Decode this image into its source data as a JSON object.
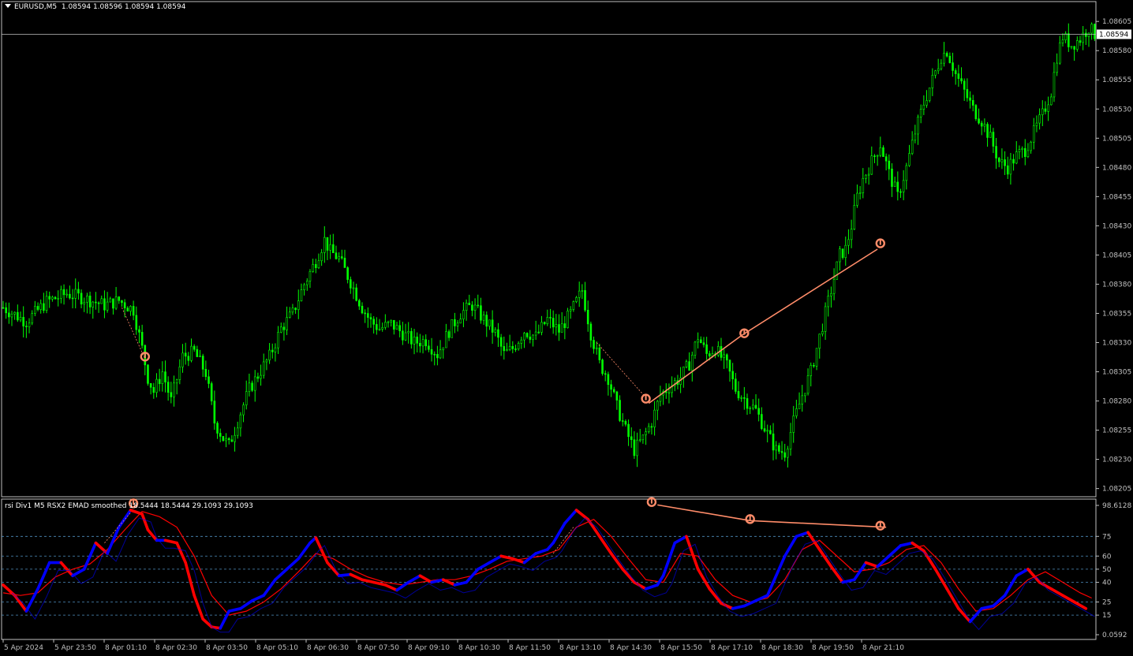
{
  "header": {
    "symbol": "EURUSD,M5",
    "ohlc": "1.08594 1.08596 1.08594 1.08594"
  },
  "indicator": {
    "title": "rsi Div1 M5 RSX2 EMAD smoothed 18.5444 18.5444 29.1093 29.1093",
    "levels": [
      "98.6128",
      "75",
      "60",
      "50",
      "40",
      "25",
      "15",
      "0.0592"
    ],
    "level_values": [
      98.6128,
      75,
      60,
      50,
      40,
      25,
      15,
      0.0592
    ]
  },
  "price_axis": {
    "labels": [
      "1.08605",
      "1.08580",
      "1.08555",
      "1.08530",
      "1.08505",
      "1.08480",
      "1.08455",
      "1.08430",
      "1.08405",
      "1.08380",
      "1.08355",
      "1.08330",
      "1.08305",
      "1.08280",
      "1.08255",
      "1.08230",
      "1.08205"
    ],
    "current_price": "1.08594",
    "current_value": 1.08594
  },
  "time_axis": {
    "labels": [
      "5 Apr 2024",
      "5 Apr 23:50",
      "8 Apr 01:10",
      "8 Apr 02:30",
      "8 Apr 03:50",
      "8 Apr 05:10",
      "8 Apr 06:30",
      "8 Apr 07:50",
      "8 Apr 09:10",
      "8 Apr 10:30",
      "8 Apr 11:50",
      "8 Apr 13:10",
      "8 Apr 14:30",
      "8 Apr 15:50",
      "8 Apr 17:10",
      "8 Apr 18:30",
      "8 Apr 19:50",
      "8 Apr 21:10"
    ]
  },
  "colors": {
    "background": "#000000",
    "candles": "#00ff00",
    "rsi_fast_up": "#0000ff",
    "rsi_fast_down": "#ff0000",
    "rsi_signal": "#ff0000",
    "divergence": "#ff8c69",
    "grid_dash": "#4f8fbf",
    "axis": "#c0c0c0"
  },
  "chart_data": {
    "type": "candlestick",
    "symbol": "EURUSD",
    "timeframe": "M5",
    "price_range": [
      1.08198,
      1.08622
    ],
    "close_path": [
      [
        0,
        1.0836
      ],
      [
        8,
        1.08348
      ],
      [
        15,
        1.08365
      ],
      [
        22,
        1.08372
      ],
      [
        28,
        1.08368
      ],
      [
        35,
        1.08362
      ],
      [
        40,
        1.08366
      ],
      [
        45,
        1.08358
      ],
      [
        48,
        1.08325
      ],
      [
        50,
        1.083
      ],
      [
        52,
        1.08288
      ],
      [
        55,
        1.08305
      ],
      [
        58,
        1.0828
      ],
      [
        62,
        1.08318
      ],
      [
        66,
        1.08322
      ],
      [
        70,
        1.08304
      ],
      [
        73,
        1.08262
      ],
      [
        76,
        1.08248
      ],
      [
        78,
        1.08242
      ],
      [
        80,
        1.08255
      ],
      [
        82,
        1.0827
      ],
      [
        85,
        1.0829
      ],
      [
        88,
        1.08302
      ],
      [
        92,
        1.08318
      ],
      [
        96,
        1.08342
      ],
      [
        100,
        1.08355
      ],
      [
        104,
        1.0838
      ],
      [
        108,
        1.084
      ],
      [
        111,
        1.08418
      ],
      [
        113,
        1.08408
      ],
      [
        116,
        1.08402
      ],
      [
        120,
        1.08382
      ],
      [
        124,
        1.0836
      ],
      [
        127,
        1.08348
      ],
      [
        130,
        1.08342
      ],
      [
        134,
        1.08346
      ],
      [
        138,
        1.08338
      ],
      [
        142,
        1.0833
      ],
      [
        146,
        1.08332
      ],
      [
        150,
        1.0832
      ],
      [
        154,
        1.0834
      ],
      [
        158,
        1.08355
      ],
      [
        162,
        1.08362
      ],
      [
        166,
        1.0835
      ],
      [
        170,
        1.08338
      ],
      [
        173,
        1.0832
      ],
      [
        176,
        1.08325
      ],
      [
        180,
        1.0834
      ],
      [
        184,
        1.08335
      ],
      [
        188,
        1.0835
      ],
      [
        192,
        1.0834
      ],
      [
        196,
        1.08355
      ],
      [
        200,
        1.08375
      ],
      [
        203,
        1.08338
      ],
      [
        206,
        1.08312
      ],
      [
        209,
        1.083
      ],
      [
        212,
        1.08275
      ],
      [
        215,
        1.08255
      ],
      [
        218,
        1.08238
      ],
      [
        221,
        1.08248
      ],
      [
        224,
        1.08262
      ],
      [
        227,
        1.08285
      ],
      [
        230,
        1.08292
      ],
      [
        234,
        1.083
      ],
      [
        237,
        1.08312
      ],
      [
        240,
        1.08335
      ],
      [
        243,
        1.0832
      ],
      [
        246,
        1.08325
      ],
      [
        250,
        1.0831
      ],
      [
        253,
        1.0829
      ],
      [
        256,
        1.08282
      ],
      [
        260,
        1.08272
      ],
      [
        264,
        1.08252
      ],
      [
        267,
        1.08238
      ],
      [
        270,
        1.08236
      ],
      [
        273,
        1.08262
      ],
      [
        276,
        1.08285
      ],
      [
        279,
        1.08305
      ],
      [
        282,
        1.08335
      ],
      [
        285,
        1.08365
      ],
      [
        287,
        1.08385
      ],
      [
        289,
        1.08405
      ],
      [
        291,
        1.0841
      ],
      [
        293,
        1.0843
      ],
      [
        295,
        1.08455
      ],
      [
        297,
        1.0847
      ],
      [
        300,
        1.08485
      ],
      [
        303,
        1.085
      ],
      [
        306,
        1.08475
      ],
      [
        309,
        1.08455
      ],
      [
        312,
        1.0848
      ],
      [
        315,
        1.0851
      ],
      [
        318,
        1.08535
      ],
      [
        321,
        1.08555
      ],
      [
        324,
        1.08575
      ],
      [
        326,
        1.0858
      ],
      [
        329,
        1.0856
      ],
      [
        332,
        1.08545
      ],
      [
        335,
        1.0853
      ],
      [
        338,
        1.0852
      ],
      [
        341,
        1.08505
      ],
      [
        344,
        1.08485
      ],
      [
        347,
        1.0848
      ],
      [
        350,
        1.0849
      ],
      [
        353,
        1.08495
      ],
      [
        356,
        1.0851
      ],
      [
        359,
        1.08525
      ],
      [
        362,
        1.08545
      ],
      [
        364,
        1.08575
      ],
      [
        366,
        1.08592
      ],
      [
        369,
        1.08585
      ],
      [
        372,
        1.0859
      ],
      [
        375,
        1.086
      ],
      [
        377,
        1.08594
      ]
    ],
    "indicator_fast": [
      [
        0,
        38
      ],
      [
        4,
        30
      ],
      [
        8,
        18
      ],
      [
        12,
        35
      ],
      [
        16,
        55
      ],
      [
        20,
        55
      ],
      [
        24,
        45
      ],
      [
        28,
        50
      ],
      [
        32,
        70
      ],
      [
        36,
        62
      ],
      [
        40,
        82
      ],
      [
        44,
        95
      ],
      [
        48,
        92
      ],
      [
        50,
        80
      ],
      [
        53,
        72
      ],
      [
        56,
        72
      ],
      [
        60,
        70
      ],
      [
        63,
        55
      ],
      [
        66,
        30
      ],
      [
        69,
        12
      ],
      [
        72,
        6
      ],
      [
        75,
        5
      ],
      [
        78,
        18
      ],
      [
        82,
        20
      ],
      [
        86,
        26
      ],
      [
        90,
        30
      ],
      [
        94,
        42
      ],
      [
        98,
        50
      ],
      [
        102,
        58
      ],
      [
        106,
        70
      ],
      [
        108,
        74
      ],
      [
        112,
        55
      ],
      [
        116,
        45
      ],
      [
        120,
        46
      ],
      [
        124,
        42
      ],
      [
        128,
        40
      ],
      [
        132,
        38
      ],
      [
        136,
        34
      ],
      [
        140,
        40
      ],
      [
        144,
        45
      ],
      [
        148,
        40
      ],
      [
        152,
        42
      ],
      [
        156,
        38
      ],
      [
        160,
        40
      ],
      [
        164,
        50
      ],
      [
        168,
        55
      ],
      [
        172,
        60
      ],
      [
        176,
        58
      ],
      [
        180,
        55
      ],
      [
        184,
        62
      ],
      [
        188,
        65
      ],
      [
        190,
        70
      ],
      [
        194,
        85
      ],
      [
        198,
        95
      ],
      [
        202,
        88
      ],
      [
        206,
        75
      ],
      [
        210,
        62
      ],
      [
        214,
        50
      ],
      [
        218,
        40
      ],
      [
        222,
        35
      ],
      [
        226,
        38
      ],
      [
        228,
        45
      ],
      [
        232,
        70
      ],
      [
        236,
        75
      ],
      [
        240,
        50
      ],
      [
        244,
        35
      ],
      [
        248,
        24
      ],
      [
        252,
        20
      ],
      [
        256,
        22
      ],
      [
        260,
        26
      ],
      [
        264,
        30
      ],
      [
        266,
        40
      ],
      [
        270,
        60
      ],
      [
        274,
        75
      ],
      [
        278,
        78
      ],
      [
        282,
        65
      ],
      [
        286,
        52
      ],
      [
        290,
        40
      ],
      [
        294,
        42
      ],
      [
        298,
        55
      ],
      [
        302,
        52
      ],
      [
        306,
        60
      ],
      [
        310,
        68
      ],
      [
        314,
        70
      ],
      [
        318,
        64
      ],
      [
        322,
        50
      ],
      [
        326,
        35
      ],
      [
        330,
        20
      ],
      [
        334,
        10
      ],
      [
        338,
        20
      ],
      [
        342,
        22
      ],
      [
        346,
        30
      ],
      [
        350,
        45
      ],
      [
        354,
        50
      ],
      [
        358,
        40
      ],
      [
        362,
        35
      ],
      [
        366,
        30
      ],
      [
        370,
        25
      ],
      [
        374,
        20
      ]
    ],
    "indicator_signal": [
      [
        0,
        32
      ],
      [
        6,
        30
      ],
      [
        12,
        32
      ],
      [
        18,
        44
      ],
      [
        24,
        50
      ],
      [
        30,
        54
      ],
      [
        36,
        65
      ],
      [
        42,
        80
      ],
      [
        48,
        94
      ],
      [
        54,
        90
      ],
      [
        60,
        82
      ],
      [
        66,
        60
      ],
      [
        72,
        30
      ],
      [
        78,
        15
      ],
      [
        84,
        18
      ],
      [
        90,
        25
      ],
      [
        96,
        35
      ],
      [
        102,
        48
      ],
      [
        108,
        62
      ],
      [
        114,
        58
      ],
      [
        120,
        50
      ],
      [
        126,
        44
      ],
      [
        132,
        40
      ],
      [
        138,
        38
      ],
      [
        144,
        40
      ],
      [
        150,
        42
      ],
      [
        156,
        42
      ],
      [
        162,
        45
      ],
      [
        168,
        50
      ],
      [
        174,
        56
      ],
      [
        180,
        58
      ],
      [
        186,
        60
      ],
      [
        192,
        65
      ],
      [
        198,
        82
      ],
      [
        204,
        88
      ],
      [
        210,
        75
      ],
      [
        216,
        58
      ],
      [
        222,
        42
      ],
      [
        228,
        40
      ],
      [
        234,
        62
      ],
      [
        240,
        60
      ],
      [
        246,
        42
      ],
      [
        252,
        30
      ],
      [
        258,
        25
      ],
      [
        264,
        28
      ],
      [
        270,
        42
      ],
      [
        276,
        65
      ],
      [
        282,
        72
      ],
      [
        288,
        60
      ],
      [
        294,
        48
      ],
      [
        300,
        50
      ],
      [
        306,
        55
      ],
      [
        312,
        65
      ],
      [
        318,
        68
      ],
      [
        324,
        55
      ],
      [
        330,
        35
      ],
      [
        336,
        18
      ],
      [
        342,
        20
      ],
      [
        348,
        30
      ],
      [
        354,
        42
      ],
      [
        360,
        48
      ],
      [
        366,
        40
      ],
      [
        372,
        32
      ],
      [
        376,
        28
      ]
    ],
    "divergence_price": [
      [
        223,
        1.08278
      ],
      [
        255,
        1.08336
      ],
      [
        302,
        1.0841
      ]
    ],
    "divergence_indicator": [
      [
        223,
        99
      ],
      [
        255,
        87
      ],
      [
        302,
        82
      ]
    ]
  }
}
